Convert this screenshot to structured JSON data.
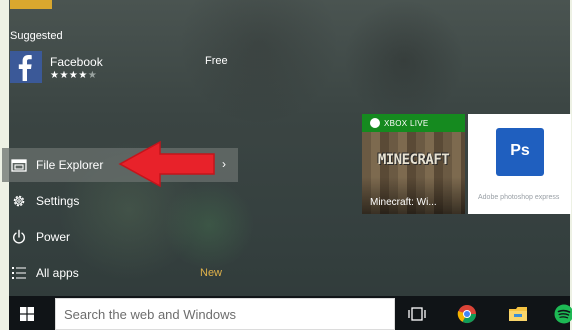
{
  "start_menu": {
    "suggested_label": "Suggested",
    "suggested_app": {
      "name": "Facebook",
      "rating_filled": "★★★★",
      "rating_empty": "★",
      "price": "Free",
      "icon": "facebook-icon"
    },
    "items": [
      {
        "label": "File Explorer",
        "icon": "file-explorer-icon",
        "chevron": "›"
      },
      {
        "label": "Settings",
        "icon": "gear-icon"
      },
      {
        "label": "Power",
        "icon": "power-icon"
      },
      {
        "label": "All apps",
        "icon": "all-apps-icon",
        "badge": "New"
      }
    ]
  },
  "tiles": [
    {
      "brand": "XBOX LIVE",
      "logo_text": "MINECRAFT",
      "label": "Minecraft: Wi...",
      "color": "#2f7a25"
    },
    {
      "icon_text": "Ps",
      "label": "Adobe photoshop express",
      "color": "#1f5fbf"
    }
  ],
  "taskbar": {
    "search_placeholder": "Search the web and Windows",
    "icons": [
      "windows-start-icon",
      "task-view-icon",
      "chrome-icon",
      "file-explorer-icon",
      "spotify-icon"
    ]
  },
  "annotation": {
    "color": "#e8222a"
  },
  "colors": {
    "accent": "#d9a72e",
    "badge": "#e0b24a",
    "taskbar": "#101417",
    "facebook": "#3b5998"
  }
}
